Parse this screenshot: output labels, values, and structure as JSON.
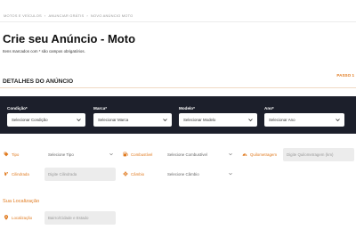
{
  "breadcrumb": [
    "MOTOS E VEÍCULOS",
    "ANUNCIAR GRÁTIS",
    "NOVO ANÚNCIO MOTO"
  ],
  "page": {
    "title": "Crie seu Anúncio - Moto",
    "subtitle": "Itens marcados com * são campos obrigatórios."
  },
  "section": {
    "title": "DETALHES DO ANÚNCIO",
    "step_label": "PASSO 1"
  },
  "selectors": [
    {
      "label": "Condição*",
      "value": "Selecionar Condição"
    },
    {
      "label": "Marca*",
      "value": "Selecionar Marca"
    },
    {
      "label": "Modelo*",
      "value": "Selecionar Modelo"
    },
    {
      "label": "Ano*",
      "value": "Selecionar Ano"
    }
  ],
  "fields": {
    "tipo": {
      "label": "Tipo",
      "value": "Selecione Tipo",
      "icon": "tag-icon"
    },
    "combustivel": {
      "label": "Combustível",
      "value": "Selecione Combustível",
      "icon": "fuel-icon"
    },
    "quilometragem": {
      "label": "Quilometragem",
      "placeholder": "Digite Quilometragem (km)",
      "icon": "speedometer-icon"
    },
    "cilindrada": {
      "label": "Cilindrada",
      "placeholder": "Digite Cilindrada",
      "icon": "engine-icon"
    },
    "cambio": {
      "label": "Câmbio",
      "value": "Selecione Câmbio",
      "icon": "gear-icon"
    }
  },
  "location": {
    "title": "Sua Localização",
    "field": {
      "label": "Localização",
      "placeholder": "Bairro/Cidade e Estado",
      "icon": "map-pin-icon"
    }
  },
  "colors": {
    "accent": "#e07a1f",
    "dark_band": "#1c1f2b",
    "input_bg": "#ececec"
  }
}
